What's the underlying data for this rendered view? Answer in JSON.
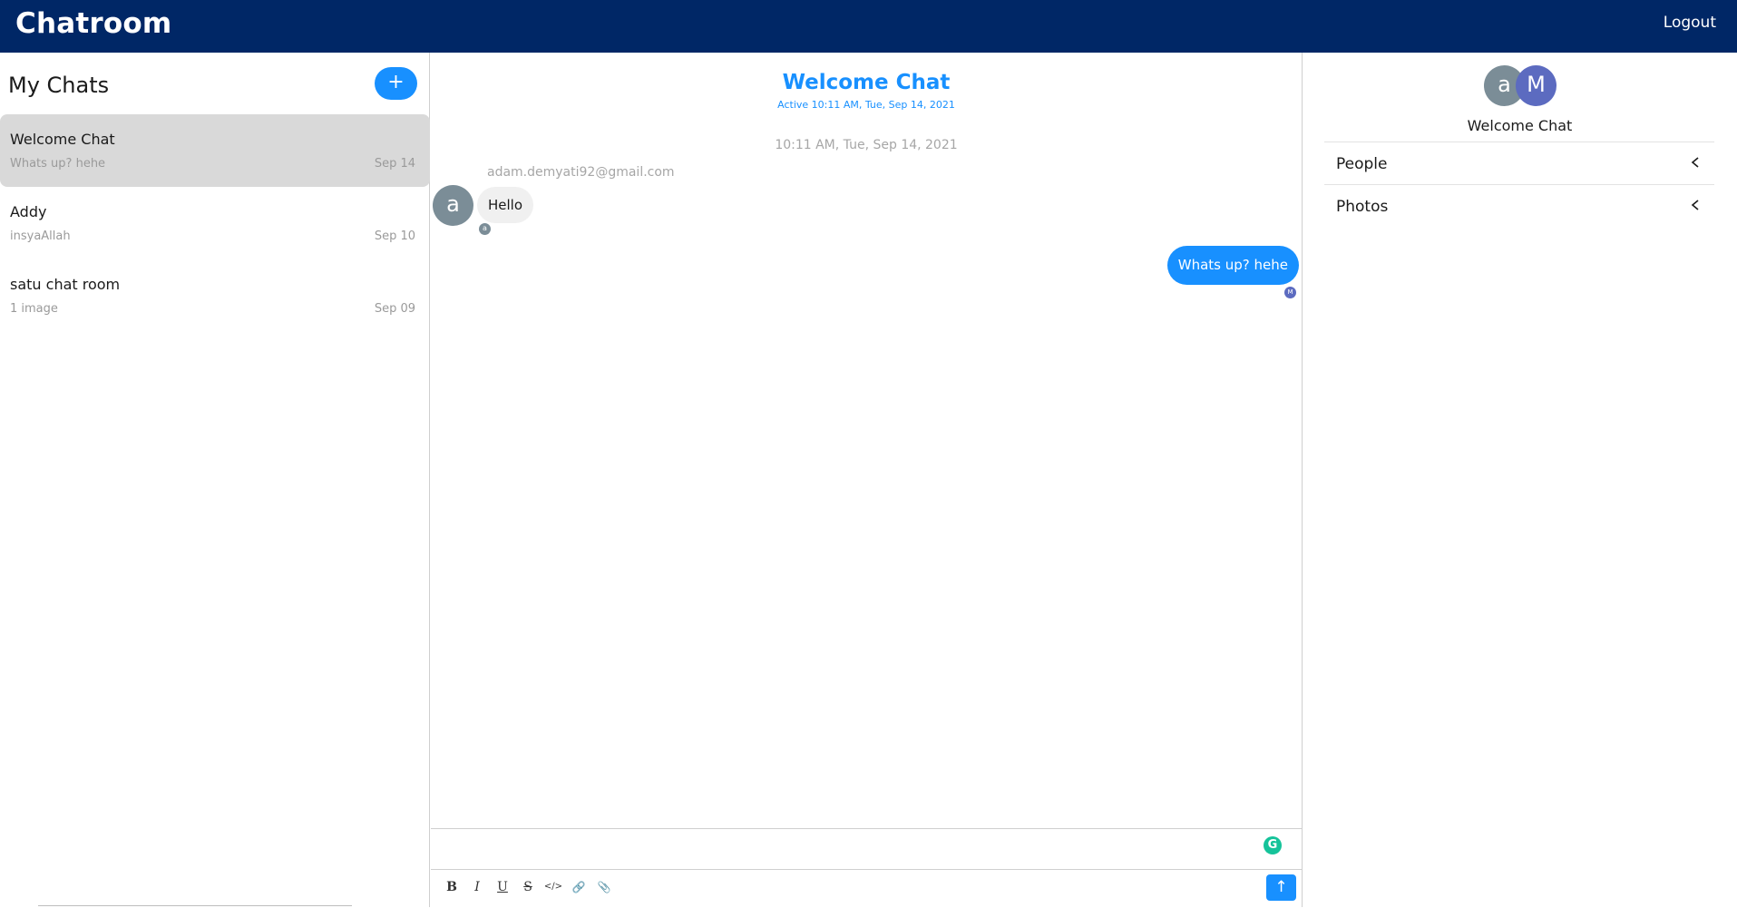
{
  "app": {
    "title": "Chatroom",
    "logout_label": "Logout"
  },
  "sidebar": {
    "title": "My Chats",
    "new_chat_label": "+",
    "chats": [
      {
        "name": "Welcome Chat",
        "preview": "Whats up? hehe",
        "date": "Sep 14",
        "active": true
      },
      {
        "name": "Addy",
        "preview": "insyaAllah",
        "date": "Sep 10",
        "active": false
      },
      {
        "name": "satu chat room",
        "preview": "1 image",
        "date": "Sep 09",
        "active": false
      }
    ]
  },
  "conversation": {
    "title": "Welcome Chat",
    "active_status": "Active 10:11 AM, Tue, Sep 14, 2021",
    "timestamp": "10:11 AM, Tue, Sep 14, 2021",
    "incoming": {
      "sender": "adam.demyati92@gmail.com",
      "avatar_letter": "a",
      "text": "Hello",
      "read_letter": "a"
    },
    "outgoing": {
      "text": "Whats up? hehe",
      "read_letter": "M"
    }
  },
  "composer": {
    "grammarly_letter": "G",
    "tools": [
      {
        "name": "bold-icon",
        "glyph": "B"
      },
      {
        "name": "italic-icon",
        "glyph": "I"
      },
      {
        "name": "underline-icon",
        "glyph": "U"
      },
      {
        "name": "strikethrough-icon",
        "glyph": "S"
      },
      {
        "name": "code-icon",
        "glyph": "</>"
      },
      {
        "name": "link-icon",
        "glyph": "🔗"
      },
      {
        "name": "attachment-icon",
        "glyph": "📎"
      }
    ],
    "send_icon": "arrow-up-icon"
  },
  "details": {
    "avatars": [
      "a",
      "M"
    ],
    "room_name": "Welcome Chat",
    "sections": [
      "People",
      "Photos"
    ]
  },
  "colors": {
    "topbar": "#002766",
    "accent": "#1890ff",
    "avatar_a": "#7b8d97",
    "avatar_m": "#5c6bc0"
  }
}
